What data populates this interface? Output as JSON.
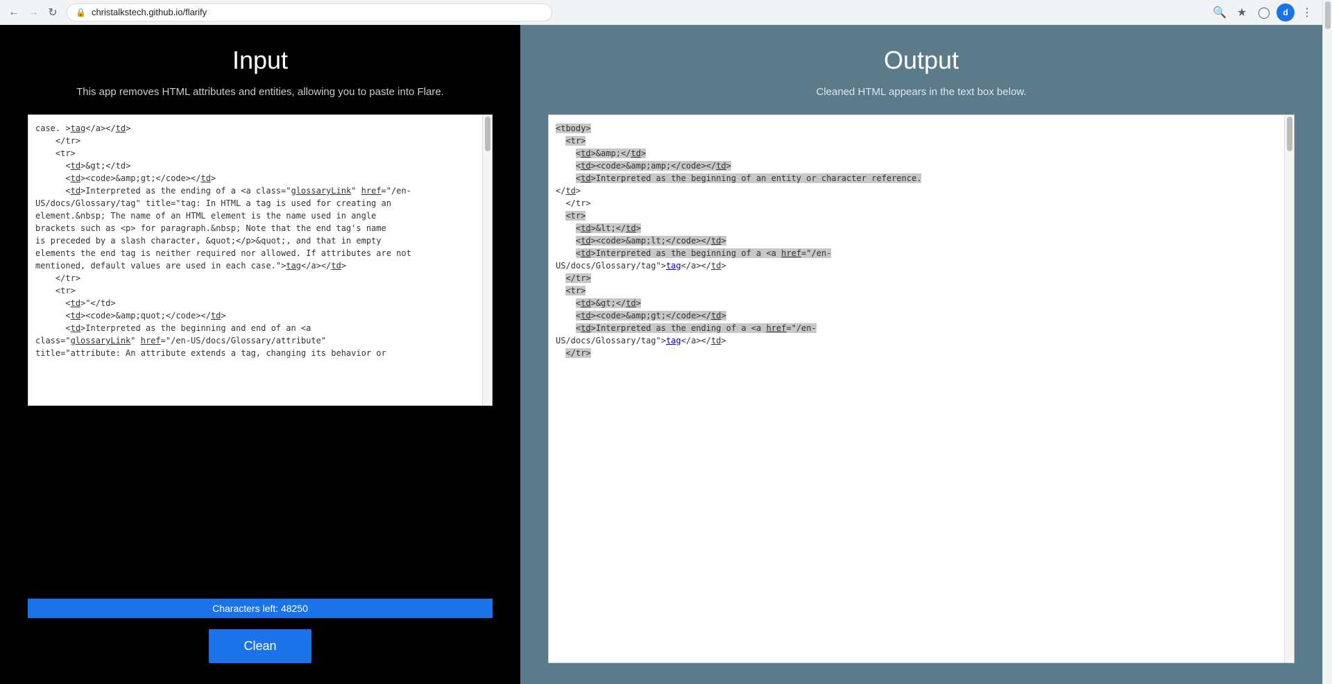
{
  "browser": {
    "url": "christalkstech.github.io/flarify",
    "user_initial": "d"
  },
  "left_panel": {
    "title": "Input",
    "description": "This app removes HTML attributes and entities, allowing you to paste into Flare.",
    "char_counter_label": "Characters left: 48250",
    "input_content": "case. >tag</a></td>\n    </tr>\n    <tr>\n      <td>&gt;</td>\n      <td><code>&amp;gt;</code></td>\n      <td>Interpreted as the ending of a <a class=\"glossaryLink\" href=\"/en-US/docs/Glossary/tag\" title=\"tag: In HTML a tag is used for creating an element.&nbsp; The name of an HTML element is the name used in angle brackets such as <p> for paragraph.&nbsp; Note that the end tag's name is preceded by a slash character, &quot;</p>&quot;, and that in empty elements the end tag is neither required nor allowed. If attributes are not mentioned, default values are used in each case.\">tag</a></td>\n    </tr>\n    <tr>\n      <td>\"</td>\n      <td><code>&amp;quot;</code></td>\n      <td>Interpreted as the beginning and end of an <a class=\"glossaryLink\" href=\"/en-US/docs/Glossary/attribute\" title=\"attribute: An attribute extends a tag, changing its behavior or"
  },
  "right_panel": {
    "title": "Output",
    "description": "Cleaned HTML appears in the text box below.",
    "output_content": "<tbody>\n  <tr>\n    <td>&amp;</td>\n    <td><code>&amp;amp;</code></td>\n    <td>Interpreted as the beginning of an entity or character reference.\n</td>\n  </tr>\n  <tr>\n    <td>&lt;</td>\n    <td><code>&amp;lt;</code></td>\n    <td>Interpreted as the beginning of a <a href=\"/en-US/docs/Glossary/tag\">tag</a></td>\n  </tr>\n  <tr>\n    <td>&gt;</td>\n    <td><code>&amp;gt;</code></td>\n    <td>Interpreted as the ending of a <a href=\"/en-US/docs/Glossary/tag\">tag</a></td>\n  </tr>"
  },
  "buttons": {
    "clean_label": "Clean"
  }
}
